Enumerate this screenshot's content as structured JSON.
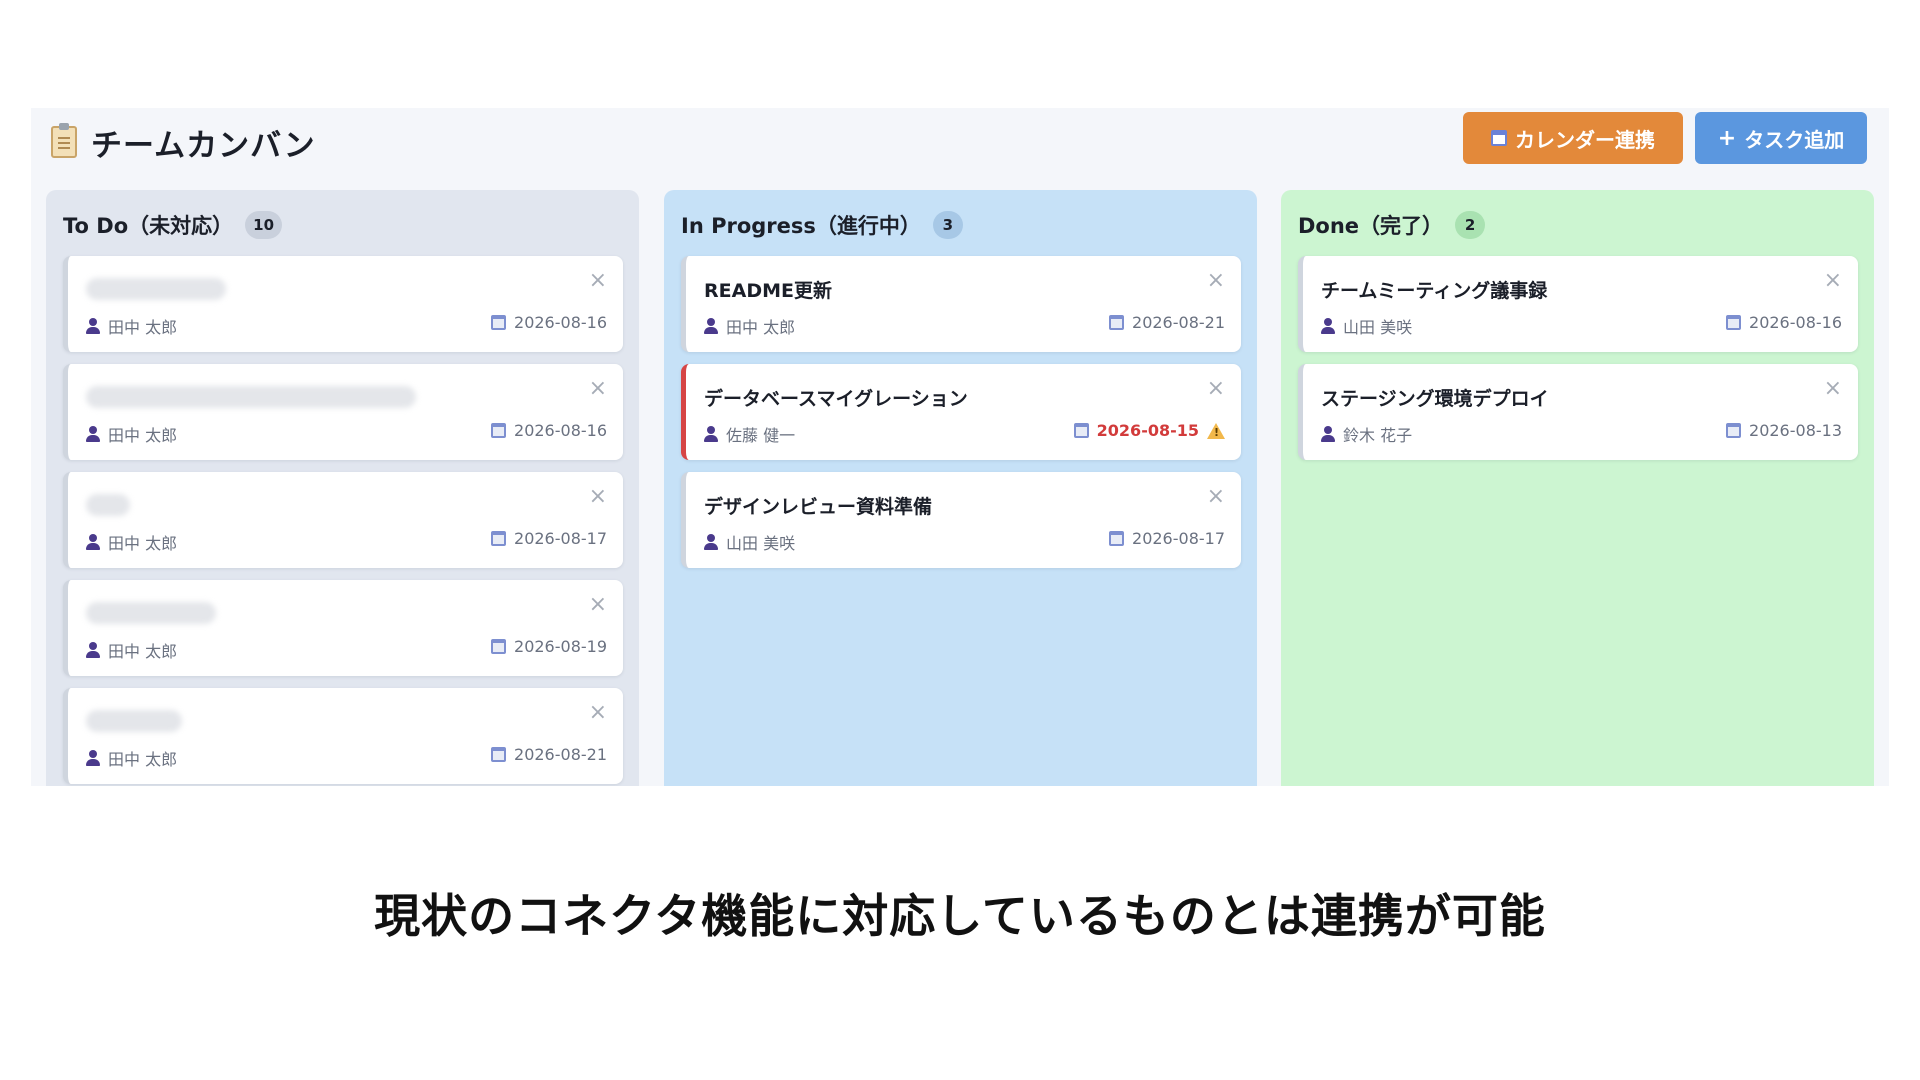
{
  "app": {
    "title": "チームカンバン",
    "buttons": {
      "calendar_label": "カレンダー連携",
      "add_label": "タスク追加",
      "add_symbol": "+"
    }
  },
  "columns": [
    {
      "title": "To Do（未対応）",
      "count": "10",
      "cards": [
        {
          "title": "",
          "assignee": "田中 太郎",
          "due": "2026-08-16",
          "overdue": false
        },
        {
          "title": "",
          "assignee": "田中 太郎",
          "due": "2026-08-16",
          "overdue": false
        },
        {
          "title": "",
          "assignee": "田中 太郎",
          "due": "2026-08-17",
          "overdue": false
        },
        {
          "title": "",
          "assignee": "田中 太郎",
          "due": "2026-08-19",
          "overdue": false
        },
        {
          "title": "",
          "assignee": "田中 太郎",
          "due": "2026-08-21",
          "overdue": false
        }
      ]
    },
    {
      "title": "In Progress（進行中）",
      "count": "3",
      "cards": [
        {
          "title": "README更新",
          "assignee": "田中 太郎",
          "due": "2026-08-21",
          "overdue": false
        },
        {
          "title": "データベースマイグレーション",
          "assignee": "佐藤 健一",
          "due": "2026-08-15",
          "overdue": true
        },
        {
          "title": "デザインレビュー資料準備",
          "assignee": "山田 美咲",
          "due": "2026-08-17",
          "overdue": false
        }
      ]
    },
    {
      "title": "Done（完了）",
      "count": "2",
      "cards": [
        {
          "title": "チームミーティング議事録",
          "assignee": "山田 美咲",
          "due": "2026-08-16",
          "overdue": false
        },
        {
          "title": "ステージング環境デプロイ",
          "assignee": "鈴木 花子",
          "due": "2026-08-13",
          "overdue": false
        }
      ]
    }
  ],
  "close_symbol": "×",
  "caption": "現状のコネクタ機能に対応しているものとは連携が可能",
  "colors": {
    "calendar_button": "#e3893a",
    "add_button": "#5b97df",
    "todo_column": "#e1e6ef",
    "progress_column": "#c6e1f7",
    "done_column": "#ccf5d1",
    "overdue": "#d23b3b"
  }
}
